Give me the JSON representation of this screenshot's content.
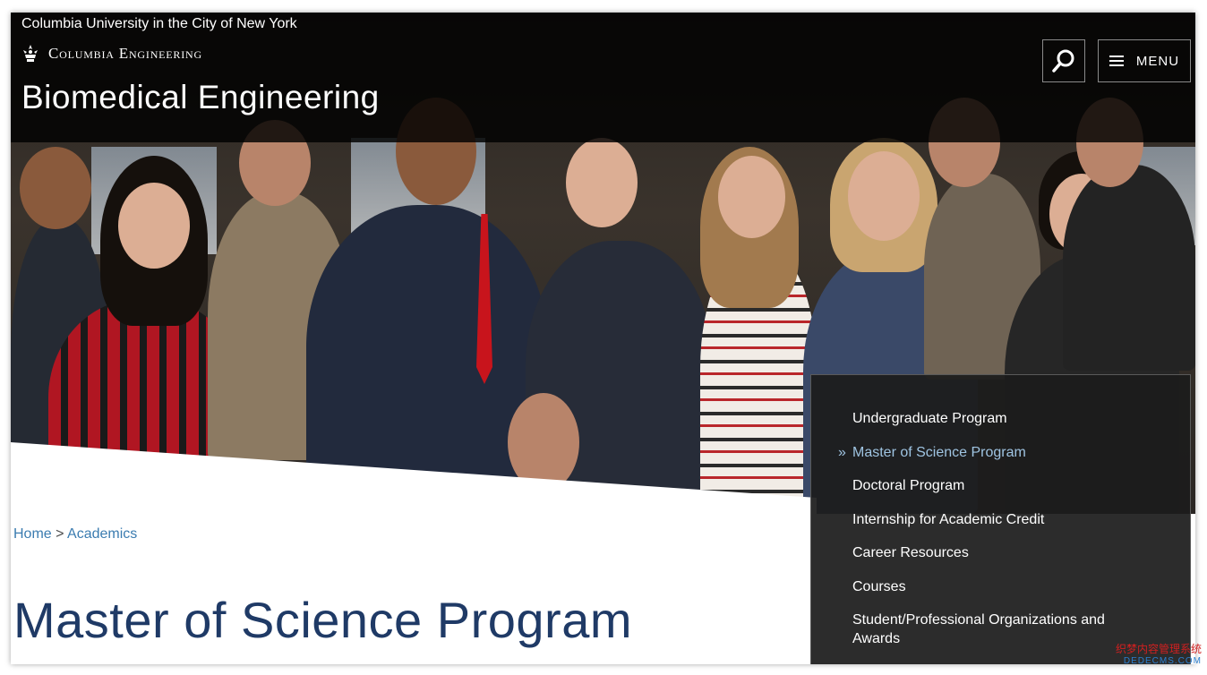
{
  "header": {
    "university_link": "Columbia University in the City of New York",
    "school_name": "Columbia Engineering",
    "department_title": "Biomedical Engineering",
    "search_icon": "search-icon",
    "menu_label": "MENU",
    "menu_icon": "hamburger-icon"
  },
  "breadcrumb": {
    "home": "Home",
    "separator": ">",
    "current": "Academics"
  },
  "page": {
    "title": "Master of Science Program"
  },
  "sidebar": {
    "active_marker": "»",
    "items": [
      {
        "label": "Undergraduate Program"
      },
      {
        "label": "Master of Science Program"
      },
      {
        "label": "Doctoral Program"
      },
      {
        "label": "Internship for Academic Credit"
      },
      {
        "label": "Career Resources"
      },
      {
        "label": "Courses"
      },
      {
        "label": "Student/Professional Organizations and Awards"
      }
    ]
  },
  "watermark": {
    "line1": "织梦内容管理系统",
    "line2": "DEDECMS.COM"
  },
  "colors": {
    "title_blue": "#1f3a66",
    "link_blue": "#3b7cb0",
    "active_nav": "#9fc4e2",
    "nav_bg": "#1c1c1c"
  }
}
